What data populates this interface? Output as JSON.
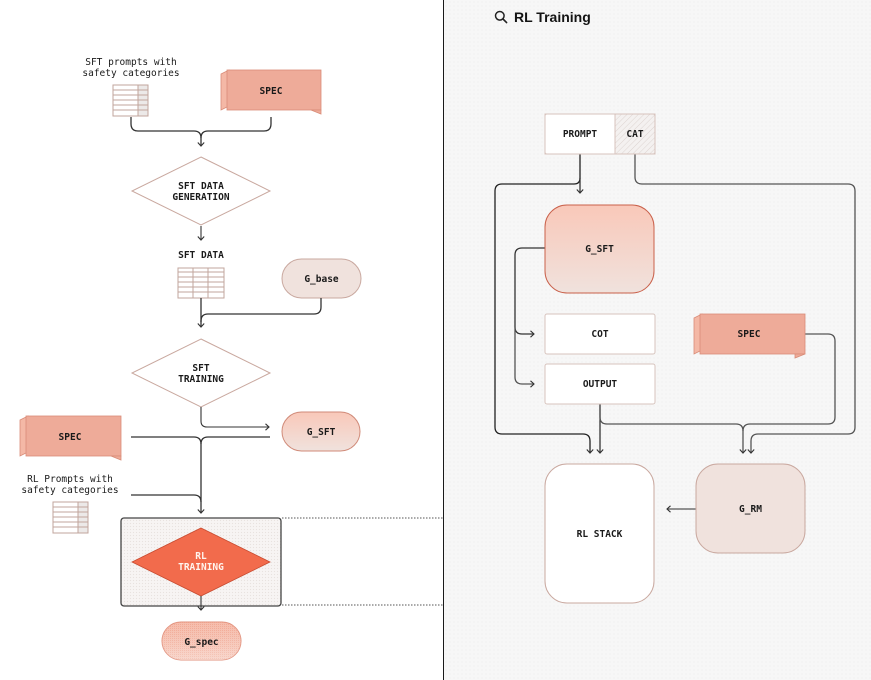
{
  "colors": {
    "spec_fill": "#eeab99",
    "spec_fold": "#f4b8a6",
    "spec_stroke": "#d98c78",
    "node_stroke": "#c9a89f",
    "table_stroke": "#c2a59c",
    "accent": "#f26b4c",
    "g_base_fill": "#f0e2dd",
    "g_rm_fill": "#f0e2dd",
    "line": "#444444"
  },
  "left_panel": {
    "sft_prompts_label": [
      "SFT prompts with",
      "safety categories"
    ],
    "spec_top": "SPEC",
    "sft_data_generation": [
      "SFT DATA",
      "GENERATION"
    ],
    "sft_data_label": "SFT DATA",
    "g_base": "G_base",
    "sft_training": [
      "SFT",
      "TRAINING"
    ],
    "g_sft": "G_SFT",
    "spec_bottom": "SPEC",
    "rl_prompts_label": [
      "RL Prompts with",
      "safety categories"
    ],
    "rl_training": [
      "RL",
      "TRAINING"
    ],
    "g_spec": "G_spec"
  },
  "right_panel": {
    "title": "RL Training",
    "title_icon": "search-icon",
    "prompt": "PROMPT",
    "cat": "CAT",
    "g_sft": "G_SFT",
    "cot": "COT",
    "output": "OUTPUT",
    "spec": "SPEC",
    "rl_stack": "RL STACK",
    "g_rm": "G_RM"
  }
}
